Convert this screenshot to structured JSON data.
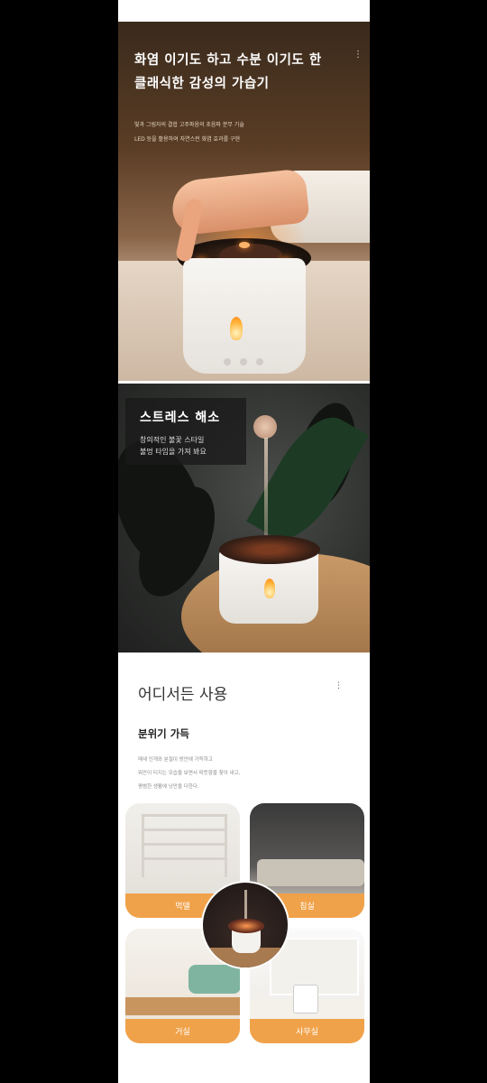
{
  "hero": {
    "title_line1": "화염 이기도 하고 수분 이기도 한",
    "title_line2": "클래식한 감성의 가습기",
    "sub_line1": "빛과 그림자의 결합 고주파음의 초음파 분무 기술",
    "sub_line2": "LED 등을 활용하여 자연스런 화염 효과를 구현",
    "menu_icon": "menu-dots-icon"
  },
  "stress": {
    "title": "스트레스 해소",
    "desc_line1": "창의적인 불꽃 스타일",
    "desc_line2": "불멍 타임을 가져 봐요"
  },
  "anywhere": {
    "title": "어디서든 사용",
    "subtitle": "분위기 가득",
    "desc_line1": "매새 인개와 분절이 방안에 가득하고",
    "desc_line2": "뭐끈이 티지는 모습을 보면서 따뜻함을 찾아 내고,",
    "desc_line3": "평범한 생활에 낭만을 더한다.",
    "menu_icon": "menu-dots-icon",
    "cards": [
      {
        "label": "먹델"
      },
      {
        "label": "침실"
      },
      {
        "label": "거실"
      },
      {
        "label": "사무실"
      }
    ]
  },
  "colors": {
    "accent": "#f0a24a",
    "background": "#000000",
    "page": "#ffffff"
  }
}
